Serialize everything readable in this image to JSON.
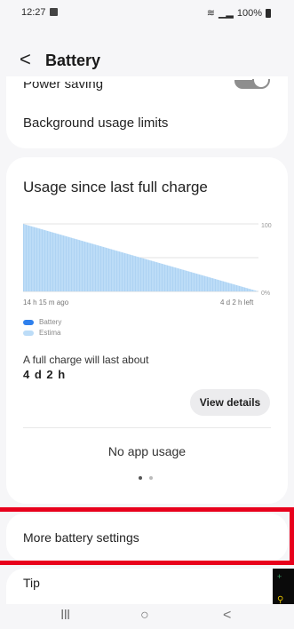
{
  "status_bar": {
    "time": "12:27",
    "right_text": "100%"
  },
  "header": {
    "back_glyph": "<",
    "title": "Battery"
  },
  "settings": {
    "power_saving_label": "Power saving",
    "power_saving_enabled": false,
    "background_usage_label": "Background usage limits"
  },
  "usage_card": {
    "title": "Usage since last full charge",
    "chart_data": {
      "type": "area",
      "series": [
        {
          "name": "Battery",
          "values": []
        },
        {
          "name": "Estima",
          "values": [
            {
              "x": "14 h 15 m ago",
              "y": 100
            },
            {
              "x": "4 d 2 h left",
              "y": 0
            }
          ]
        }
      ],
      "x_start_label": "14 h 15 m ago",
      "x_end_label": "4 d 2 h left",
      "y_tick_labels": [
        "100",
        "0%"
      ],
      "ylim": [
        0,
        100
      ],
      "grid": true,
      "legend_position": "bottom-left",
      "colors": {
        "battery": "#2f80ed",
        "estimated": "#bcdcf7"
      }
    },
    "legend": [
      "Battery",
      "Estima"
    ],
    "full_charge_label": "A full charge will last about",
    "full_charge_value": "4 d 2 h",
    "view_details_label": "View details",
    "no_app_usage": "No app usage"
  },
  "more_settings_label": "More battery settings",
  "tip_label": "Tip",
  "nav": {
    "recents_glyph": "III",
    "home_glyph": "○",
    "back_glyph": "<"
  },
  "colors": {
    "highlight": "#e8001c",
    "background": "#f6f6f8",
    "card": "#ffffff"
  }
}
